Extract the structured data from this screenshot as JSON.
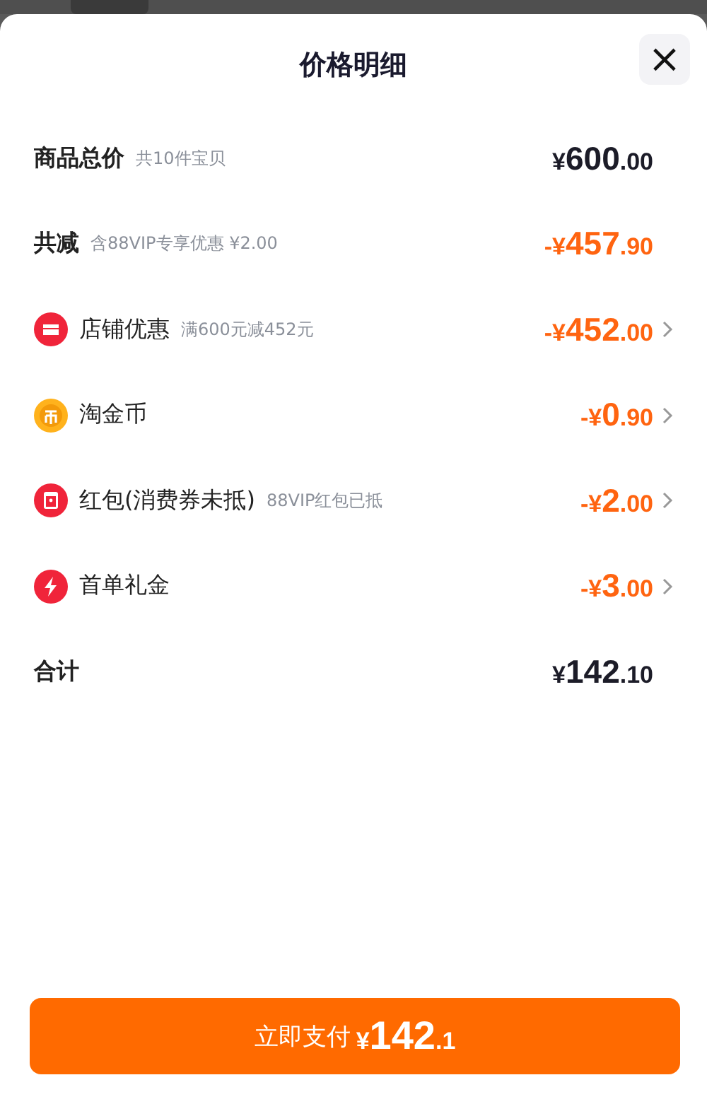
{
  "sheet": {
    "title": "价格明细",
    "close": "×"
  },
  "rows": [
    {
      "kind": "total",
      "label": "商品总价",
      "note": "共10件宝贝",
      "amount": "¥600.00"
    },
    {
      "kind": "saving",
      "label": "共减",
      "note": "含88VIP专享优惠 ¥2.00",
      "amount": "-¥457.90"
    },
    {
      "kind": "item",
      "label": "店铺优惠",
      "note": "满600元减452元",
      "amount": "-¥452.00"
    },
    {
      "kind": "item",
      "label": "淘金币",
      "amount": "-¥0.90"
    },
    {
      "kind": "item",
      "label": "红包(消费券未抵)",
      "note": "88VIP红包已抵",
      "amount": "-¥2.00"
    },
    {
      "kind": "item",
      "label": "首单礼金",
      "amount": "-¥3.00"
    },
    {
      "kind": "total",
      "label": "合计",
      "amount": "¥142.10"
    }
  ],
  "pay_button": {
    "label": "立即支付",
    "amount": "¥142.1"
  }
}
